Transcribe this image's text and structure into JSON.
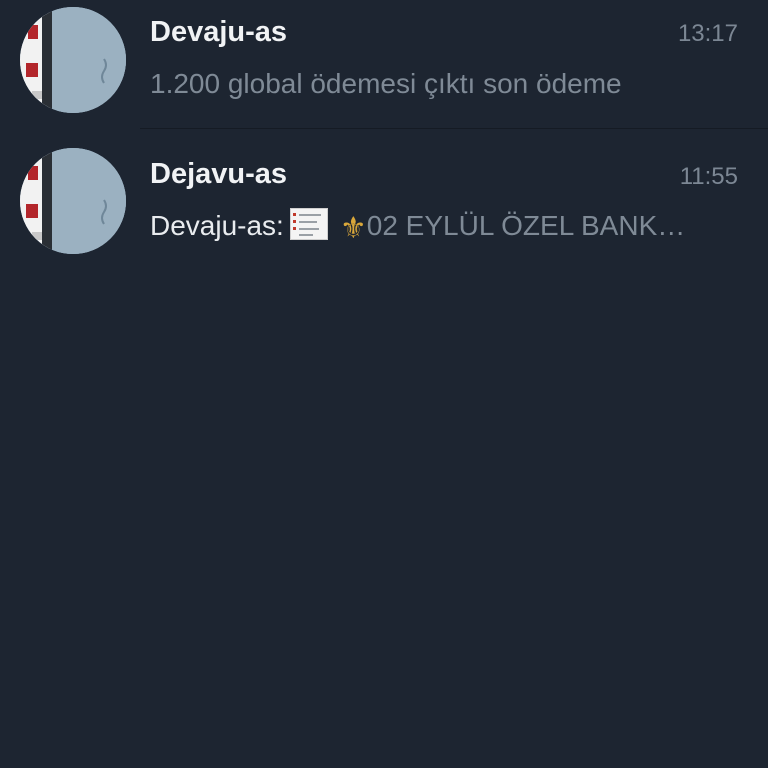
{
  "chats": [
    {
      "name": "Devaju-as",
      "time": "13:17",
      "preview": "1.200 global ödemesi çıktı son ödeme"
    },
    {
      "name": "Dejavu-as",
      "time": "11:55",
      "preview_sender": "Devaju-as:",
      "preview_text": "02 EYLÜL ÖZEL BANK…",
      "preview_icons": [
        "image-thumbnail-icon",
        "fleur-de-lis-icon"
      ]
    }
  ],
  "colors": {
    "background": "#1d2531",
    "name": "#f1f3f5",
    "secondary": "#7f8a96",
    "accent_icon": "#d9a73a"
  }
}
